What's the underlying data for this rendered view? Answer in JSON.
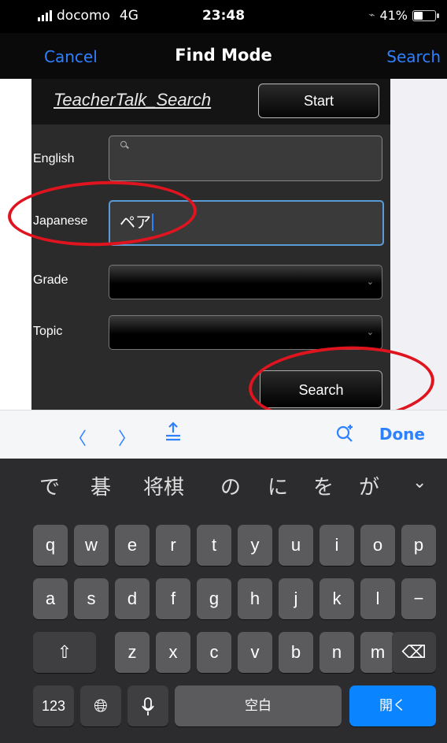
{
  "status": {
    "carrier": "docomo",
    "network": "4G",
    "time": "23:48",
    "battery": "41%",
    "battery_level": 0.41
  },
  "nav": {
    "cancel": "Cancel",
    "title": "Find Mode",
    "search": "Search"
  },
  "form": {
    "header_title": "TeacherTalk_Search",
    "start_button": "Start",
    "fields": {
      "english_label": "English",
      "japanese_label": "Japanese",
      "japanese_value": "ペア",
      "grade_label": "Grade",
      "topic_label": "Topic"
    },
    "search_button": "Search"
  },
  "accessory": {
    "prev": "〈",
    "next": "〉",
    "done": "Done"
  },
  "keyboard": {
    "candidates": [
      "で",
      "碁",
      "将棋",
      "の",
      "に",
      "を",
      "が"
    ],
    "row1": [
      "q",
      "w",
      "e",
      "r",
      "t",
      "y",
      "u",
      "i",
      "o",
      "p"
    ],
    "row2": [
      "a",
      "s",
      "d",
      "f",
      "g",
      "h",
      "j",
      "k",
      "l",
      "−"
    ],
    "row3": [
      "z",
      "x",
      "c",
      "v",
      "b",
      "n",
      "m"
    ],
    "numbers": "123",
    "space": "空白",
    "return": "開く"
  },
  "colors": {
    "accent": "#2f80ff",
    "annotation": "#e0141e",
    "keyboard_bg": "#2c2c2e"
  }
}
